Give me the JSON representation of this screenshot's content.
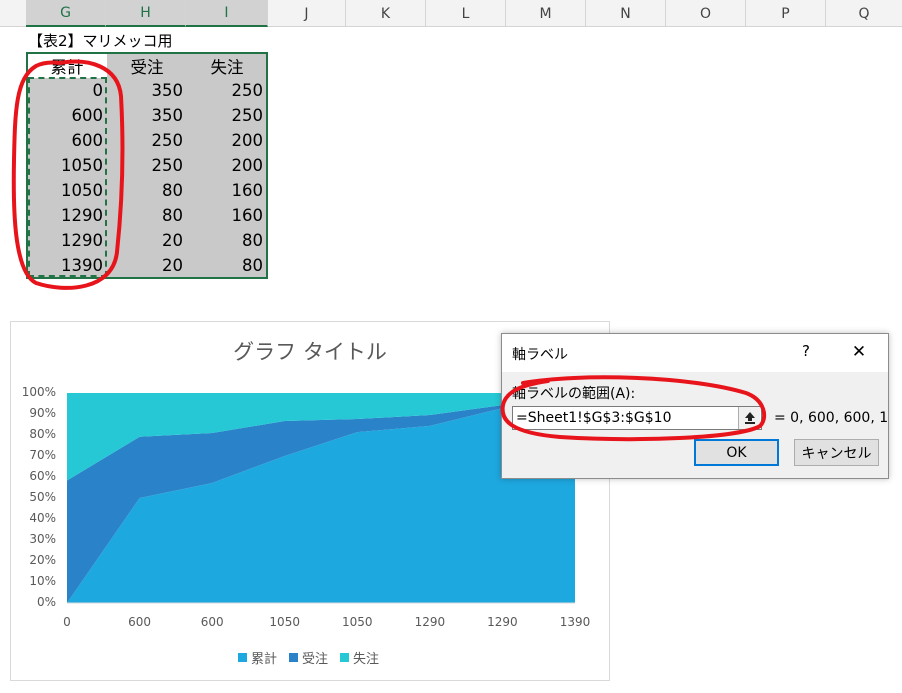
{
  "columns": [
    "G",
    "H",
    "I",
    "J",
    "K",
    "L",
    "M",
    "N",
    "O",
    "P",
    "Q"
  ],
  "sheet": {
    "table_title": "【表2】マリメッコ用",
    "headers": [
      "累計",
      "受注",
      "失注"
    ],
    "rows": [
      [
        "0",
        "350",
        "250"
      ],
      [
        "600",
        "350",
        "250"
      ],
      [
        "600",
        "250",
        "200"
      ],
      [
        "1050",
        "250",
        "200"
      ],
      [
        "1050",
        "80",
        "160"
      ],
      [
        "1290",
        "80",
        "160"
      ],
      [
        "1290",
        "20",
        "80"
      ],
      [
        "1390",
        "20",
        "80"
      ]
    ]
  },
  "chart_data": {
    "type": "area",
    "title": "グラフ タイトル",
    "stacked": "percent",
    "categories": [
      "0",
      "600",
      "600",
      "1050",
      "1050",
      "1290",
      "1290",
      "1390"
    ],
    "series": [
      {
        "name": "累計",
        "values": [
          0,
          600,
          600,
          1050,
          1050,
          1290,
          1290,
          1390
        ],
        "color": "#1ea8e0"
      },
      {
        "name": "受注",
        "values": [
          350,
          350,
          250,
          250,
          80,
          80,
          20,
          20
        ],
        "color": "#2a83c8"
      },
      {
        "name": "失注",
        "values": [
          250,
          250,
          200,
          200,
          160,
          160,
          80,
          80
        ],
        "color": "#26c8d6"
      }
    ],
    "yticks": [
      "0%",
      "10%",
      "20%",
      "30%",
      "40%",
      "50%",
      "60%",
      "70%",
      "80%",
      "90%",
      "100%"
    ],
    "ylim": [
      0,
      100
    ],
    "legend": "bottom",
    "grid": false
  },
  "dialog": {
    "title": "軸ラベル",
    "help": "?",
    "close": "✕",
    "field_label": "軸ラベルの範囲(A):",
    "field_value": "=Sheet1!$G$3:$G$10",
    "preview": "= 0, 600, 600, 1",
    "ok": "OK",
    "cancel": "キャンセル"
  },
  "colors": {
    "excel_green": "#217346",
    "annotation_red": "#e8141b",
    "focus_blue": "#0078d7"
  }
}
